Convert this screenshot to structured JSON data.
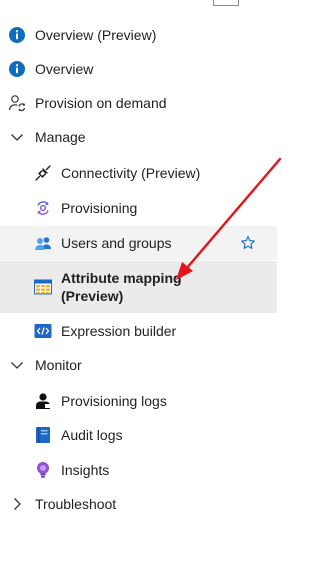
{
  "nav": {
    "overview_preview": "Overview (Preview)",
    "overview": "Overview",
    "provision_on_demand": "Provision on demand",
    "manage": "Manage",
    "connectivity_preview": "Connectivity (Preview)",
    "provisioning": "Provisioning",
    "users_and_groups": "Users and groups",
    "attribute_mapping_preview": "Attribute mapping (Preview)",
    "expression_builder": "Expression builder",
    "monitor": "Monitor",
    "provisioning_logs": "Provisioning logs",
    "audit_logs": "Audit logs",
    "insights": "Insights",
    "troubleshoot": "Troubleshoot"
  },
  "colors": {
    "info_blue": "#0f6cbd",
    "arrow_red": "#e3141a",
    "selected_bg": "#ebebeb",
    "hover_bg": "#f3f3f3"
  },
  "icons": {
    "overview_preview": "info-icon",
    "overview": "info-icon",
    "provision_on_demand": "person-sync-icon",
    "manage": "chevron-down-icon",
    "connectivity_preview": "plug-icon",
    "provisioning": "gear-sync-icon",
    "users_and_groups": "users-icon",
    "attribute_mapping_preview": "table-icon",
    "expression_builder": "code-icon",
    "monitor": "chevron-down-icon",
    "provisioning_logs": "person-log-icon",
    "audit_logs": "book-icon",
    "insights": "lightbulb-icon",
    "troubleshoot": "chevron-right-icon",
    "favorite": "star-icon"
  }
}
